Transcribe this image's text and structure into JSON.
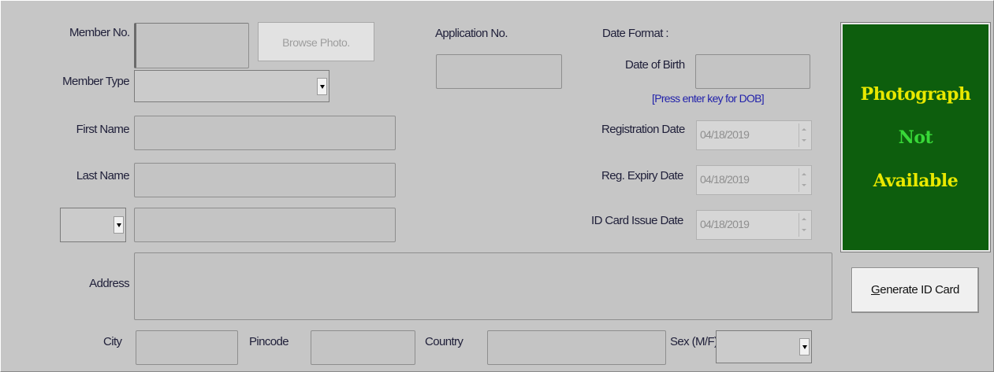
{
  "labels": {
    "member_no": "Member No.",
    "member_type": "Member Type",
    "first_name": "First Name",
    "last_name": "Last Name",
    "address": "Address",
    "city": "City",
    "pincode": "Pincode",
    "country": "Country",
    "sex": "Sex (M/F)",
    "application_no": "Application No.",
    "date_format": "Date Format :",
    "date_of_birth": "Date of Birth",
    "dob_hint": "[Press enter key for DOB]",
    "registration_date": "Registration Date",
    "reg_expiry_date": "Reg. Expiry Date",
    "id_card_issue_date": "ID Card Issue Date"
  },
  "buttons": {
    "browse_photo": "Browse Photo.",
    "generate_id_card_prefix": "G",
    "generate_id_card_rest": "enerate ID Card"
  },
  "fields": {
    "member_no": "",
    "member_type": "",
    "first_name": "",
    "last_name": "",
    "title": "",
    "middle": "",
    "address": "",
    "city": "",
    "pincode": "",
    "country": "",
    "sex": "",
    "application_no": "",
    "date_of_birth": "",
    "registration_date": "04/18/2019",
    "reg_expiry_date": "04/18/2019",
    "id_card_issue_date": "04/18/2019"
  },
  "photo": {
    "line1": "Photograph",
    "line2": "Not",
    "line3": "Available"
  },
  "colors": {
    "photo_bg": "#0d5e0d",
    "photo_yellow": "#e8e800",
    "photo_green": "#38d838",
    "hint_blue": "#2222aa"
  }
}
